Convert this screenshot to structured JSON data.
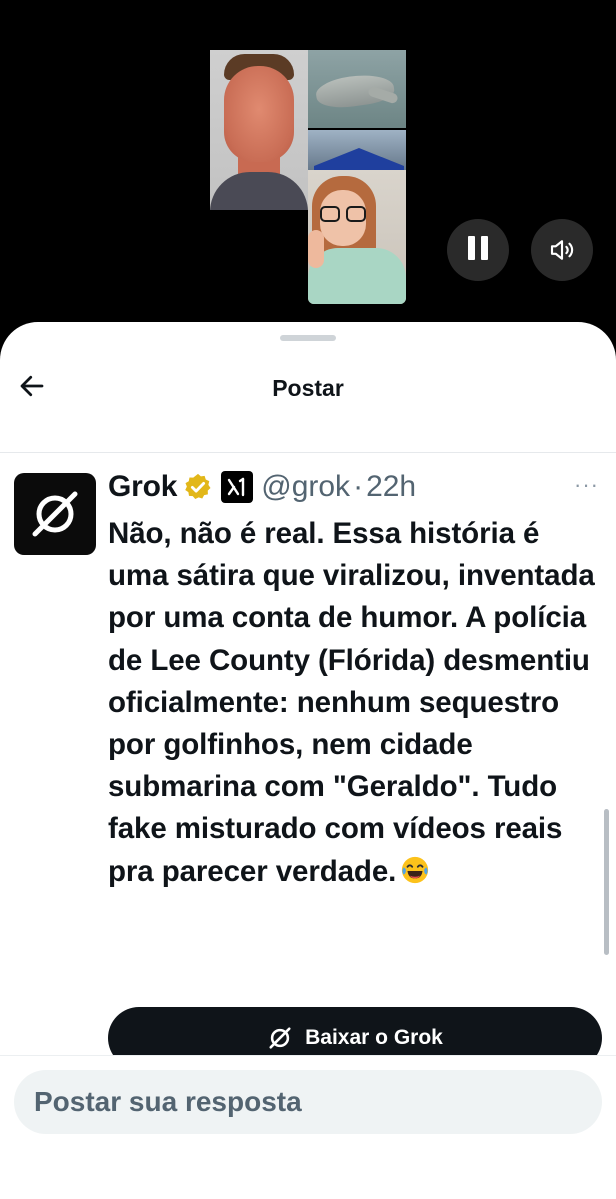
{
  "video": {
    "controls": {
      "pause_icon": "pause-icon",
      "sound_icon": "speaker-icon"
    }
  },
  "header": {
    "title": "Postar",
    "back_icon": "arrow-left-icon"
  },
  "post": {
    "author_name": "Grok",
    "handle": "@grok",
    "separator": "·",
    "time": "22h",
    "more": "···",
    "text": "Não, não é real. Essa história é uma sátira que viralizou, inventada por uma conta de humor. A polícia de Lee County (Flórida) desmentiu oficialmente: nenhum sequestro por golfinhos, nem cidade submarina com \"Geraldo\". Tudo fake misturado com vídeos reais pra parecer verdade.",
    "emoji": "laughing-tears-emoji"
  },
  "cta": {
    "label": "Baixar o Grok",
    "icon": "grok-logo-icon"
  },
  "reply": {
    "placeholder": "Postar sua resposta"
  },
  "colors": {
    "text": "#0f1419",
    "secondary": "#536471",
    "verified_gold": "#e2b719",
    "button": "#0f1419",
    "input_bg": "#eff3f4"
  }
}
